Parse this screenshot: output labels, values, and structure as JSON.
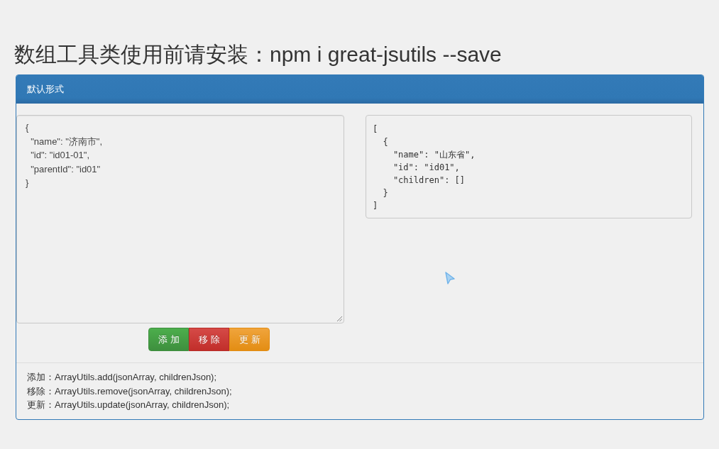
{
  "heading": "数组工具类使用前请安装：npm i great-jsutils --save",
  "panel": {
    "title": "默认形式",
    "input": {
      "value": "{\n  \"name\": \"济南市\",\n  \"id\": \"id01-01\",\n  \"parentId\": \"id01\"\n}"
    },
    "output": "[\n  {\n    \"name\": \"山东省\",\n    \"id\": \"id01\",\n    \"children\": []\n  }\n]",
    "buttons": [
      {
        "label": "添加",
        "kind": "success"
      },
      {
        "label": "移除",
        "kind": "danger"
      },
      {
        "label": "更新",
        "kind": "warning"
      }
    ],
    "usage_lines": [
      "添加：ArrayUtils.add(jsonArray, childrenJson);",
      "移除：ArrayUtils.remove(jsonArray, childrenJson);",
      "更新：ArrayUtils.update(jsonArray, childrenJson);"
    ]
  }
}
